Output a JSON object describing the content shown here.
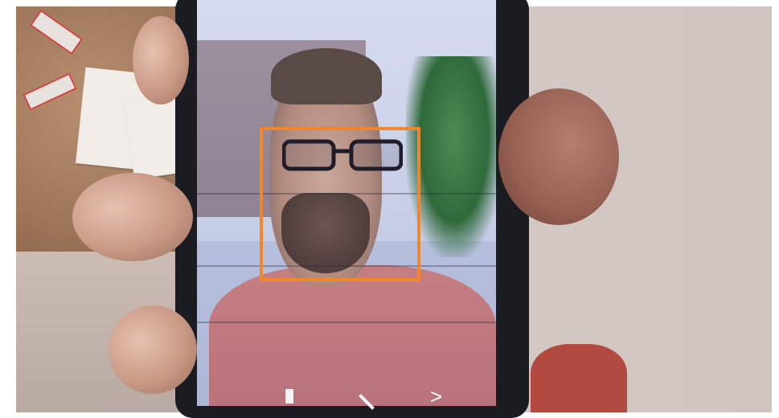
{
  "image": {
    "description_free": true
  },
  "overlay": {
    "face_box_color": "#f2862a"
  },
  "nav_icons": [
    "recents-icon",
    "home-icon",
    "back-icon"
  ],
  "labels": {
    "recents": "",
    "home": "",
    "back": ">"
  }
}
